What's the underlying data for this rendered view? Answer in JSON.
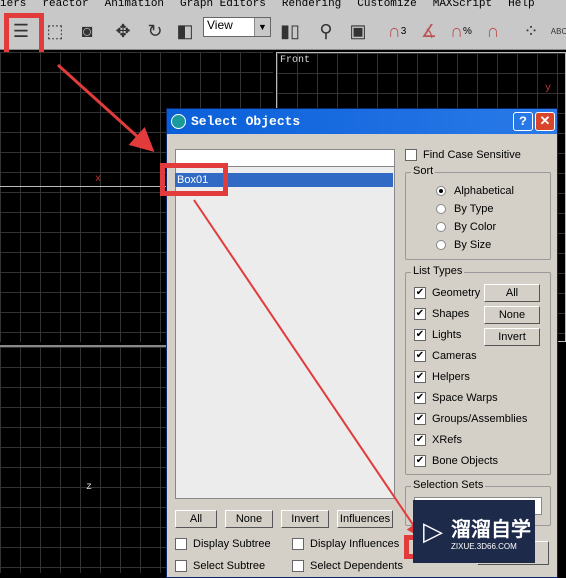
{
  "menu": [
    "iers",
    "reactor",
    "Animation",
    "Graph Editors",
    "Rendering",
    "Customize",
    "MAXScript",
    "Help"
  ],
  "toolbar": {
    "view_dropdown": "View",
    "abc_label": "ABC",
    "snap_angle_label": "3",
    "percent_label": "%"
  },
  "viewports": {
    "front_label": "Front",
    "x_axis": "x",
    "y_axis": "y",
    "z_axis": "z"
  },
  "dialog": {
    "title": "Select Objects",
    "help_button": "?",
    "close_button": "✕",
    "objects": [
      "Box01"
    ],
    "find_case_sensitive": {
      "label": "Find Case Sensitive",
      "checked": false
    },
    "sort": {
      "label": "Sort",
      "options": [
        "Alphabetical",
        "By Type",
        "By Color",
        "By Size"
      ],
      "selected": "Alphabetical"
    },
    "list_types": {
      "label": "List Types",
      "items": [
        {
          "label": "Geometry",
          "checked": true
        },
        {
          "label": "Shapes",
          "checked": true
        },
        {
          "label": "Lights",
          "checked": true
        },
        {
          "label": "Cameras",
          "checked": true
        },
        {
          "label": "Helpers",
          "checked": true
        },
        {
          "label": "Space Warps",
          "checked": true
        },
        {
          "label": "Groups/Assemblies",
          "checked": true
        },
        {
          "label": "XRefs",
          "checked": true
        },
        {
          "label": "Bone Objects",
          "checked": true
        }
      ],
      "buttons": [
        "All",
        "None",
        "Invert"
      ]
    },
    "selection_sets": {
      "label": "Selection Sets"
    },
    "bottom_buttons": [
      "All",
      "None",
      "Invert",
      "Influences"
    ],
    "options": [
      {
        "label": "Display Subtree",
        "checked": false
      },
      {
        "label": "Display Influences",
        "checked": false
      },
      {
        "label": "Select Subtree",
        "checked": false
      },
      {
        "label": "Select Dependents",
        "checked": false
      }
    ]
  },
  "watermark": {
    "text": "溜溜自学",
    "url": "ZIXUE.3D66.COM"
  },
  "colors": {
    "highlight": "#e23b3b",
    "title_bar": "#0a5fd8",
    "selection": "#316ac5"
  }
}
